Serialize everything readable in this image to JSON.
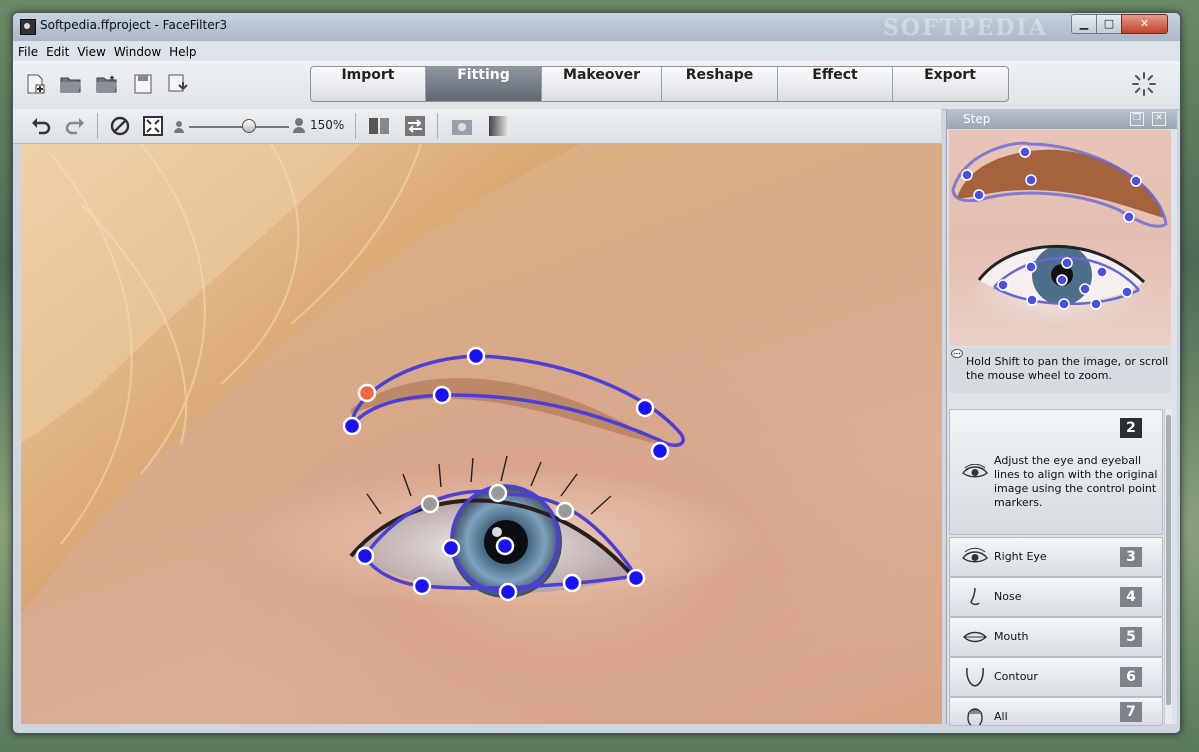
{
  "window": {
    "title": "Softpedia.ffproject - FaceFilter3",
    "watermark": "SOFTPEDIA",
    "controls": {
      "minimize": "▁",
      "maximize": "□",
      "close": "✕"
    }
  },
  "menu": [
    "File",
    "Edit",
    "View",
    "Window",
    "Help"
  ],
  "toolbar": {
    "file_icons": [
      "new-project-icon",
      "open-folder-icon",
      "open-recent-icon",
      "save-icon",
      "export-file-icon"
    ],
    "tabs": [
      {
        "label": "Import",
        "active": false
      },
      {
        "label": "Fitting",
        "active": true
      },
      {
        "label": "Makeover",
        "active": false
      },
      {
        "label": "Reshape",
        "active": false
      },
      {
        "label": "Effect",
        "active": false
      },
      {
        "label": "Export",
        "active": false
      }
    ]
  },
  "subtoolbar": {
    "zoom_value": "150%",
    "zoom_level": 0.6
  },
  "side": {
    "header": "Step",
    "hint": "Hold Shift to pan the image, or scroll the mouse wheel to zoom.",
    "current_step": {
      "number": "2",
      "description": "Adjust the eye and eyeball lines to align with the original image using the control point markers."
    },
    "steps": [
      {
        "number": "3",
        "label": "Right Eye",
        "icon": "eye-icon"
      },
      {
        "number": "4",
        "label": "Nose",
        "icon": "nose-icon"
      },
      {
        "number": "5",
        "label": "Mouth",
        "icon": "mouth-icon"
      },
      {
        "number": "6",
        "label": "Contour",
        "icon": "contour-icon"
      },
      {
        "number": "7",
        "label": "All",
        "icon": "face-icon"
      }
    ]
  },
  "colors": {
    "fit_line": "#4b3fd6",
    "control_point": "#1a12f0",
    "selected_point": "#f06a40",
    "inactive_point": "#9a9a9a"
  }
}
